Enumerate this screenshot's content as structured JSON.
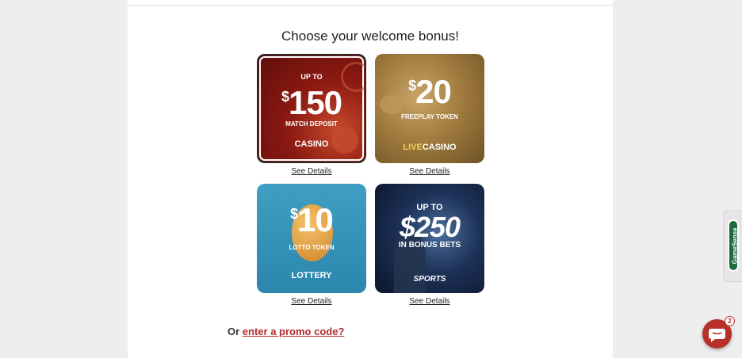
{
  "heading": "Choose your welcome bonus!",
  "cards": [
    {
      "top": "UP TO",
      "dollar": "$",
      "amount": "150",
      "sub": "MATCH DEPOSIT",
      "product": "CASINO",
      "see_details": "See Details"
    },
    {
      "dollar": "$",
      "amount": "20",
      "sub": "FREEPLAY TOKEN",
      "product_live": "LIVE",
      "product": "CASINO",
      "see_details": "See Details"
    },
    {
      "dollar": "$",
      "amount": "10",
      "sub": "LOTTO TOKEN",
      "product": "LOTTERY",
      "see_details": "See Details"
    },
    {
      "top": "UP TO",
      "amount": "$250",
      "sub": "IN BONUS BETS",
      "product": "SPORTS",
      "see_details": "See Details"
    }
  ],
  "promo": {
    "prefix": "Or",
    "link": "enter a promo code?"
  },
  "gamesense": {
    "label": "GameSense"
  },
  "chat": {
    "badge": "2"
  },
  "colors": {
    "accent": "#b7302a",
    "casino": "#8c1a12",
    "live_casino": "#a27c40",
    "lottery": "#2b86ad",
    "sports": "#1d3157"
  }
}
